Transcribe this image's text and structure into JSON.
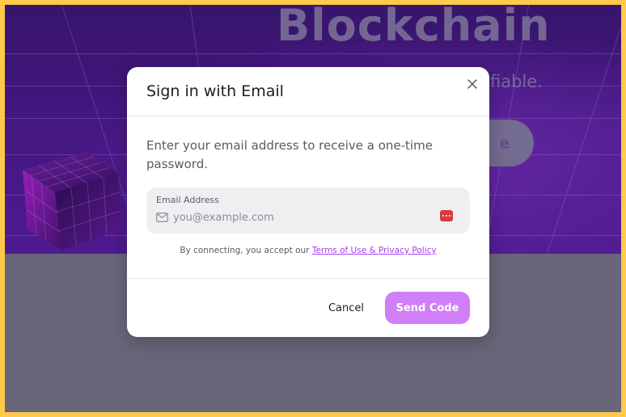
{
  "hero": {
    "title": "Blockchain",
    "subtitle_fragment": "fiable.",
    "button_fragment": "e"
  },
  "modal": {
    "title": "Sign in with Email",
    "close_icon": "close-icon",
    "description": "Enter your email address to receive a one-time password.",
    "email_field": {
      "label": "Email Address",
      "placeholder": "you@example.com",
      "value": "",
      "icon": "mail-icon",
      "autofill_icon": "password-manager-icon"
    },
    "terms_prefix": "By connecting, you accept our ",
    "terms_link": "Terms of Use & Privacy Policy",
    "cancel_label": "Cancel",
    "send_label": "Send Code"
  },
  "colors": {
    "frame_border": "#ffc94a",
    "accent": "#d07ff7",
    "link": "#a53ff0",
    "autofill_icon": "#d93a3a"
  }
}
